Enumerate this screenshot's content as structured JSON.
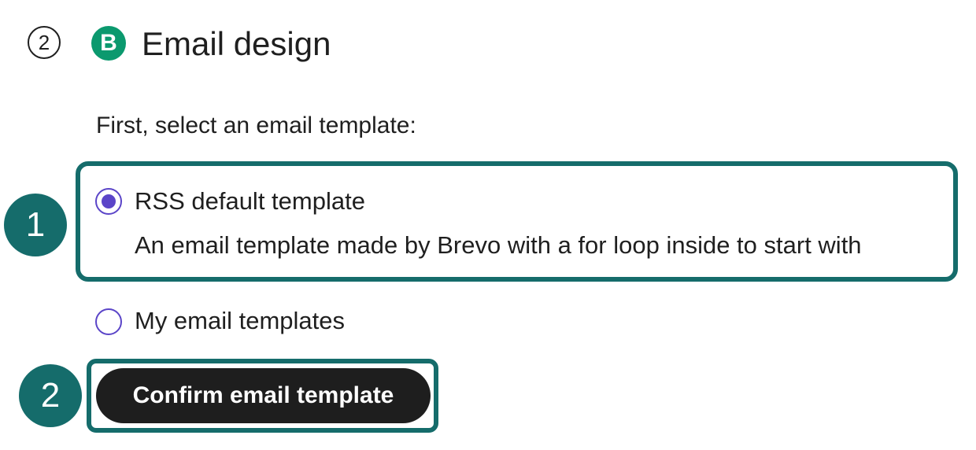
{
  "header": {
    "step_number": "2",
    "brand_icon_letter": "B",
    "title": "Email design"
  },
  "prompt": "First, select an email template:",
  "options": [
    {
      "label": "RSS default template",
      "description": "An email template made by Brevo with a for loop inside to start with",
      "selected": true
    },
    {
      "label": "My email templates",
      "selected": false
    }
  ],
  "confirm_button_label": "Confirm email template",
  "annotations": {
    "badge_1": "1",
    "badge_2": "2"
  },
  "colors": {
    "brand": "#0b996e",
    "annotation": "#156c6b",
    "radio_accent": "#5b45c8",
    "button_bg": "#1e1e1e"
  },
  "icons": {
    "brand": "brevo-logo-icon"
  }
}
